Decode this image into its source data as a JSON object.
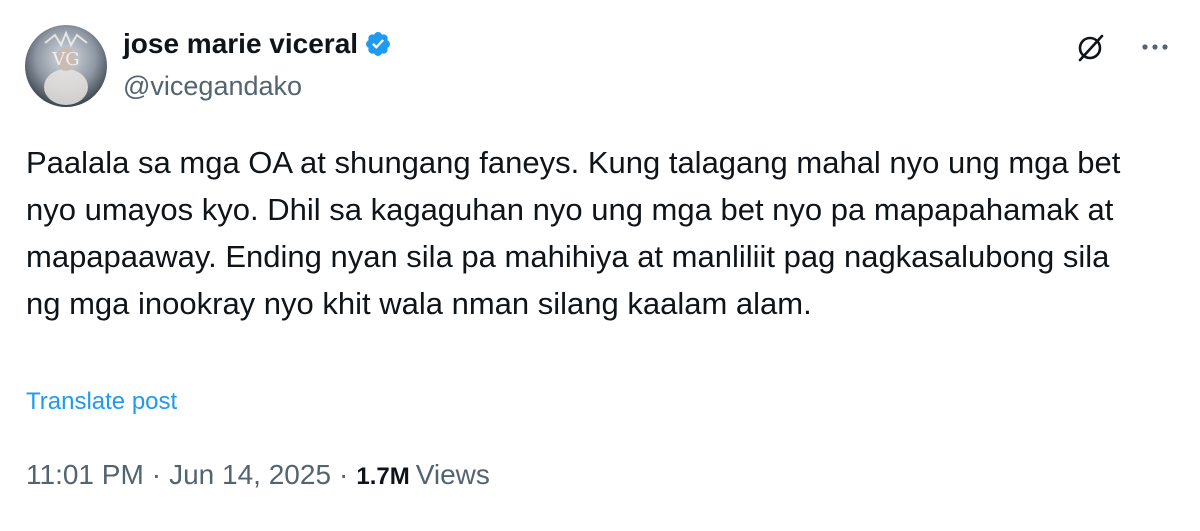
{
  "author": {
    "display_name": "jose marie viceral",
    "handle": "@vicegandako",
    "verified_icon": "verified-badge-icon",
    "avatar_initials": "VG"
  },
  "tweet": {
    "text": "Paalala sa mga OA at shungang faneys. Kung talagang mahal nyo ung mga bet nyo umayos kyo. Dhil sa kagaguhan nyo ung mga bet nyo pa mapapahamak at mapapaaway. Ending nyan sila pa mahihiya at manliliit pag nagkasalubong sila ng mga inookray nyo khit wala nman silang kaalam alam.",
    "translate_label": "Translate post",
    "time": "11:01 PM",
    "date": "Jun 14, 2025",
    "separator": "·",
    "views_count": "1.7M",
    "views_label": "Views"
  },
  "actions": {
    "grok_icon": "grok-icon",
    "more_icon": "more-options-icon"
  },
  "colors": {
    "text_primary": "#0f1419",
    "text_secondary": "#536471",
    "link": "#1d9bf0",
    "verified": "#1d9bf0"
  }
}
